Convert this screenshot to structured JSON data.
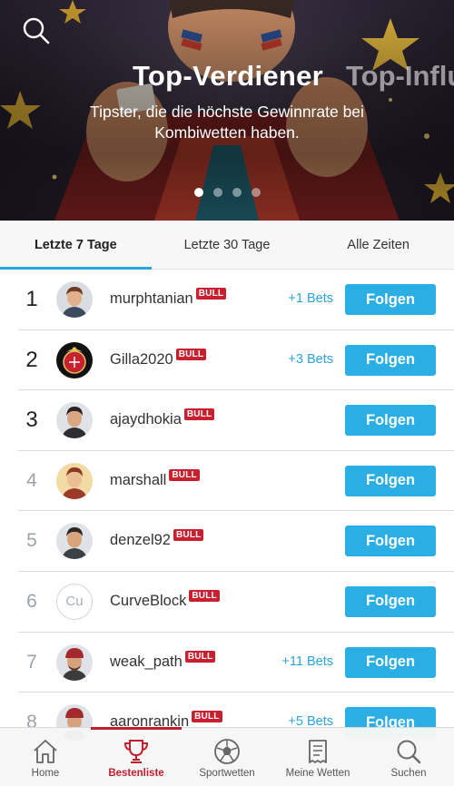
{
  "hero": {
    "title": "Top-Verdiener",
    "next_title": "Top-Influ",
    "subtitle": "Tipster, die die höchste Gewinnrate bei Kombiwetten haben.",
    "dots": [
      true,
      false,
      false,
      false
    ]
  },
  "tabs": [
    {
      "label": "Letzte 7 Tage",
      "active": true
    },
    {
      "label": "Letzte 30 Tage",
      "active": false
    },
    {
      "label": "Alle Zeiten",
      "active": false
    }
  ],
  "badge_label": "BULL",
  "follow_label": "Folgen",
  "rows": [
    {
      "rank": "1",
      "name": "murphtanian",
      "bets": "+1 Bets",
      "avatar": "man-icon"
    },
    {
      "rank": "2",
      "name": "Gilla2020",
      "bets": "+3 Bets",
      "avatar": "club-crest-icon"
    },
    {
      "rank": "3",
      "name": "ajaydhokia",
      "bets": "",
      "avatar": "man-icon"
    },
    {
      "rank": "4",
      "name": "marshall",
      "bets": "",
      "avatar": "man-icon"
    },
    {
      "rank": "5",
      "name": "denzel92",
      "bets": "",
      "avatar": "man-icon"
    },
    {
      "rank": "6",
      "name": "CurveBlock",
      "bets": "",
      "avatar_initials": "Cu"
    },
    {
      "rank": "7",
      "name": "weak_path",
      "bets": "+11 Bets",
      "avatar": "man-icon"
    },
    {
      "rank": "8",
      "name": "aaronrankin",
      "bets": "+5 Bets",
      "avatar": "man-icon"
    }
  ],
  "nav": [
    {
      "label": "Home",
      "icon": "home-icon",
      "active": false
    },
    {
      "label": "Bestenliste",
      "icon": "trophy-icon",
      "active": true
    },
    {
      "label": "Sportwetten",
      "icon": "soccer-ball-icon",
      "active": false
    },
    {
      "label": "Meine Wetten",
      "icon": "bet-slip-icon",
      "active": false
    },
    {
      "label": "Suchen",
      "icon": "search-icon",
      "active": false
    }
  ],
  "colors": {
    "accent": "#2aaee3",
    "brand_red": "#c01f2d",
    "badge_red": "#c8202f"
  }
}
